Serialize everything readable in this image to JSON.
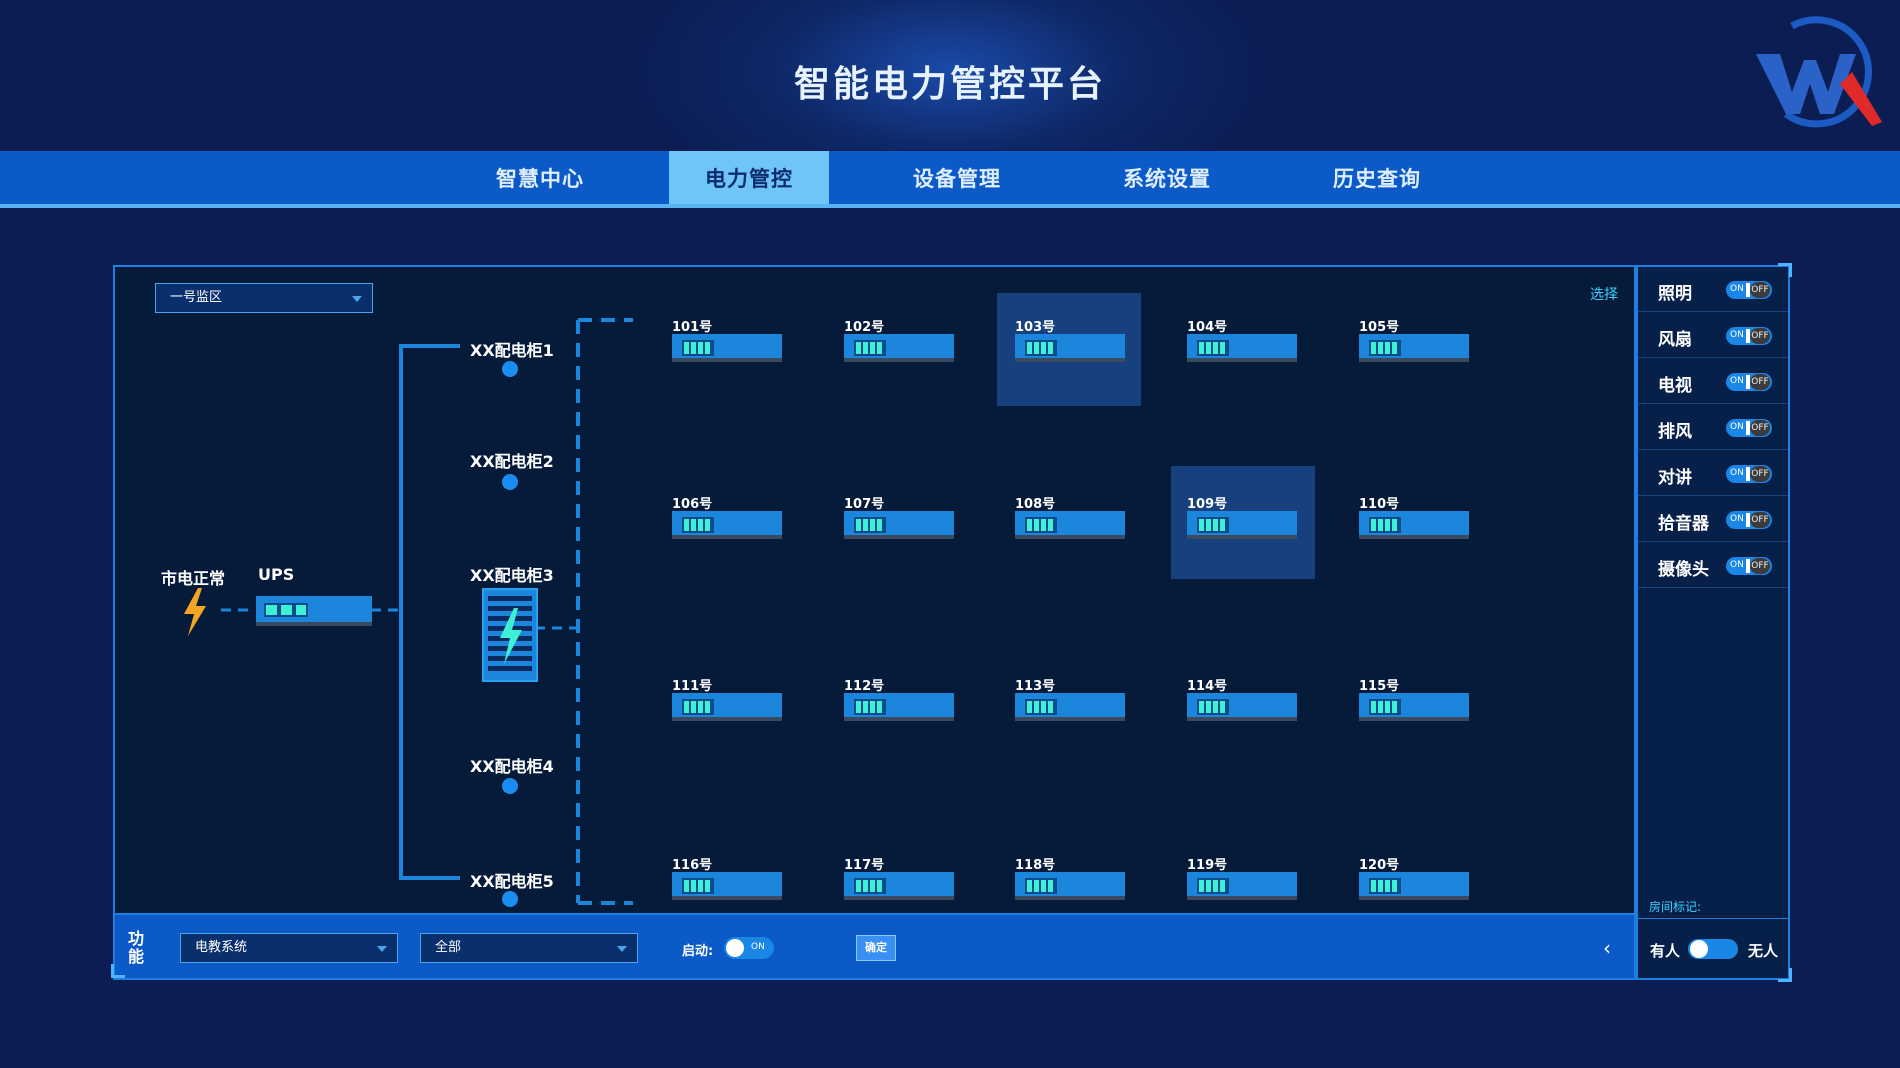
{
  "header": {
    "title": "智能电力管控平台"
  },
  "nav": {
    "tabs": [
      {
        "label": "智慧中心",
        "active": false
      },
      {
        "label": "电力管控",
        "active": true
      },
      {
        "label": "设备管理",
        "active": false
      },
      {
        "label": "系统设置",
        "active": false
      },
      {
        "label": "历史查询",
        "active": false
      }
    ]
  },
  "panel": {
    "zone_select": "一号监区",
    "select_link": "选择",
    "mains_label": "市电正常",
    "ups_label": "UPS",
    "cabinets": [
      "XX配电柜1",
      "XX配电柜2",
      "XX配电柜3",
      "XX配电柜4",
      "XX配电柜5"
    ],
    "rooms": [
      "101号",
      "102号",
      "103号",
      "104号",
      "105号",
      "106号",
      "107号",
      "108号",
      "109号",
      "110号",
      "111号",
      "112号",
      "113号",
      "114号",
      "115号",
      "116号",
      "117号",
      "118号",
      "119号",
      "120号"
    ],
    "highlighted_rooms": [
      "103号",
      "109号"
    ]
  },
  "devices": {
    "on_label": "ON",
    "off_label": "OFF",
    "items": [
      {
        "label": "照明"
      },
      {
        "label": "风扇"
      },
      {
        "label": "电视"
      },
      {
        "label": "排风"
      },
      {
        "label": "对讲"
      },
      {
        "label": "拾音器"
      },
      {
        "label": "摄像头"
      }
    ],
    "room_mark_label": "房间标记:",
    "occupied_label": "有人",
    "unoccupied_label": "无人"
  },
  "bottom": {
    "function_label": "功能",
    "system_select": "电教系统",
    "scope_select": "全部",
    "start_label": "启动:",
    "start_toggle": "ON",
    "confirm_label": "确定",
    "collapse_icon": "chevron-left-icon"
  },
  "colors": {
    "accent": "#1b86dc",
    "nav_bg": "#0c5ac8",
    "active_tab": "#6fc4f8",
    "lightning": "#f5a623"
  }
}
